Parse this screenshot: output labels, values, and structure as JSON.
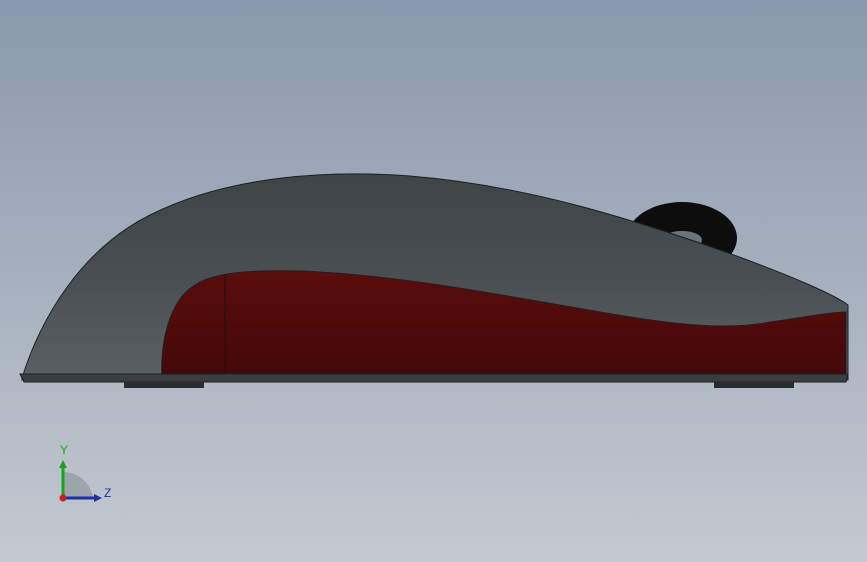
{
  "triad": {
    "y_label": "Y",
    "z_label": "Z",
    "colors": {
      "y_axis": "#1aa31a",
      "z_axis": "#1f2fa8",
      "x_axis": "#c81e1e"
    }
  },
  "model": {
    "body_color": "#44494c",
    "side_panel_color": "#4e0b0b",
    "wheel_color": "#0d0d0d",
    "feet_color": "#2a2c2f"
  }
}
